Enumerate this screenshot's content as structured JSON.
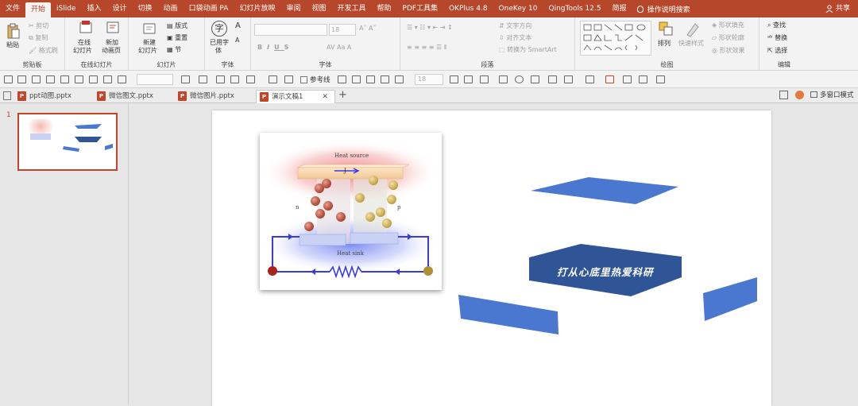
{
  "menu": {
    "tabs": [
      "文件",
      "开始",
      "iSlide",
      "插入",
      "设计",
      "切换",
      "动画",
      "口袋动画 PA",
      "幻灯片放映",
      "审阅",
      "视图",
      "开发工具",
      "帮助",
      "PDF工具集",
      "OKPlus 4.8",
      "OneKey 10",
      "QingTools 12.5",
      "简报"
    ],
    "active": "开始",
    "tell_me": "操作说明搜索",
    "share": "共享"
  },
  "ribbon": {
    "clipboard": {
      "paste": "粘贴",
      "cut": "剪切",
      "copy": "复制",
      "format_painter": "格式刷",
      "label": "剪贴板"
    },
    "online": {
      "online_slides": "在线",
      "online_slides2": "幻灯片",
      "new_anim": "新加",
      "new_anim2": "动画页",
      "label": "在线幻灯片"
    },
    "slides": {
      "new_slide": "新建",
      "new_slide2": "幻灯片",
      "layout": "版式",
      "reset": "重置",
      "section": "节",
      "label": "幻灯片"
    },
    "font_cmd": {
      "used_font": "已用字",
      "used_font2": "体",
      "label": "字体"
    },
    "font": {
      "size": "18",
      "label": "字体"
    },
    "paragraph": {
      "text_dir": "文字方向",
      "align_text": "对齐文本",
      "smartart": "转换为 SmartArt",
      "label": "段落"
    },
    "drawing": {
      "arrange": "排列",
      "quick_styles": "快速样式",
      "fill": "形状填充",
      "outline": "形状轮廓",
      "effects": "形状效果",
      "label": "绘图"
    },
    "editing": {
      "find": "查找",
      "replace": "替换",
      "select": "选择",
      "label": "编辑"
    }
  },
  "quickbar": {
    "font_size": "18",
    "ref_line": "参考线"
  },
  "doc_tabs": [
    {
      "name": "ppt动图.pptx"
    },
    {
      "name": "微信图文.pptx"
    },
    {
      "name": "微信图片.pptx"
    },
    {
      "name": "演示文稿1"
    }
  ],
  "multi_window": "多窗口模式",
  "slide_number": "1",
  "figure": {
    "heat_source": "Heat source",
    "heat_sink": "Heat sink",
    "current": "J",
    "n_label": "n",
    "p_label": "p"
  },
  "slide_text": "打从心底里热爱科研",
  "colors": {
    "brand": "#b7472a",
    "shape_blue": "#4a78d0",
    "shape_dark": "#2f5597"
  }
}
